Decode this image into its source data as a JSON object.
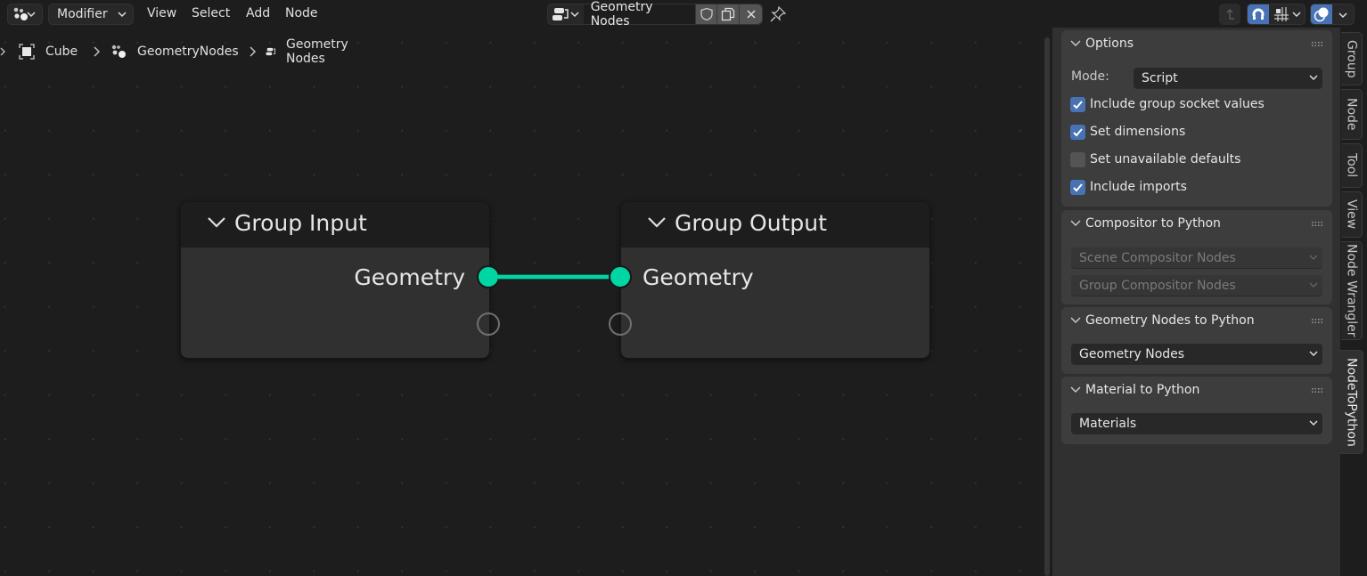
{
  "header": {
    "editor_type_icon": "node-tree-icon",
    "mode": "Modifier",
    "menus": [
      "View",
      "Select",
      "Add",
      "Node"
    ],
    "node_tree": {
      "type_icon": "node-group-icon",
      "name": "Geometry Nodes",
      "fake_user_icon": "shield-icon",
      "duplicate_icon": "duplicate-icon",
      "unlink_icon": "close-icon"
    },
    "pin_icon": "pin-icon",
    "parent_icon": "parent-arrow-icon",
    "snap_enabled": true,
    "snap_icon": "magnet-icon",
    "snap_mode_icon": "snap-grid-icon",
    "overlay_enabled": true,
    "overlay_icon": "overlay-icon"
  },
  "breadcrumb": {
    "items": [
      {
        "icon": "mesh-cube-icon",
        "label": "Cube"
      },
      {
        "icon": "modifier-nodes-icon",
        "label": "GeometryNodes"
      },
      {
        "icon": "node-group-icon",
        "label": "Geometry Nodes"
      }
    ]
  },
  "nodes": {
    "group_input": {
      "title": "Group Input",
      "outputs": [
        "Geometry"
      ]
    },
    "group_output": {
      "title": "Group Output",
      "inputs": [
        "Geometry"
      ]
    },
    "link_color": "#00d6a3"
  },
  "sidebar": {
    "options": {
      "title": "Options",
      "mode_label": "Mode:",
      "mode_value": "Script",
      "checks": [
        {
          "label": "Include group socket values",
          "checked": true
        },
        {
          "label": "Set dimensions",
          "checked": true
        },
        {
          "label": "Set unavailable defaults",
          "checked": false
        },
        {
          "label": "Include imports",
          "checked": true
        }
      ]
    },
    "compositor": {
      "title": "Compositor to Python",
      "scene_dropdown": "Scene Compositor Nodes",
      "group_dropdown": "Group Compositor Nodes"
    },
    "geometry": {
      "title": "Geometry Nodes to Python",
      "dropdown": "Geometry Nodes"
    },
    "material": {
      "title": "Material to Python",
      "dropdown": "Materials"
    }
  },
  "tabs": [
    {
      "label": "Group",
      "active": false
    },
    {
      "label": "Node",
      "active": false
    },
    {
      "label": "Tool",
      "active": false
    },
    {
      "label": "View",
      "active": false
    },
    {
      "label": "Node Wrangler",
      "active": false
    },
    {
      "label": "NodeToPython",
      "active": true
    }
  ],
  "colors": {
    "accent": "#4772b3",
    "geometry_socket": "#00d6a3",
    "background": "#1d1d1d",
    "panel": "#3d3d3d"
  }
}
